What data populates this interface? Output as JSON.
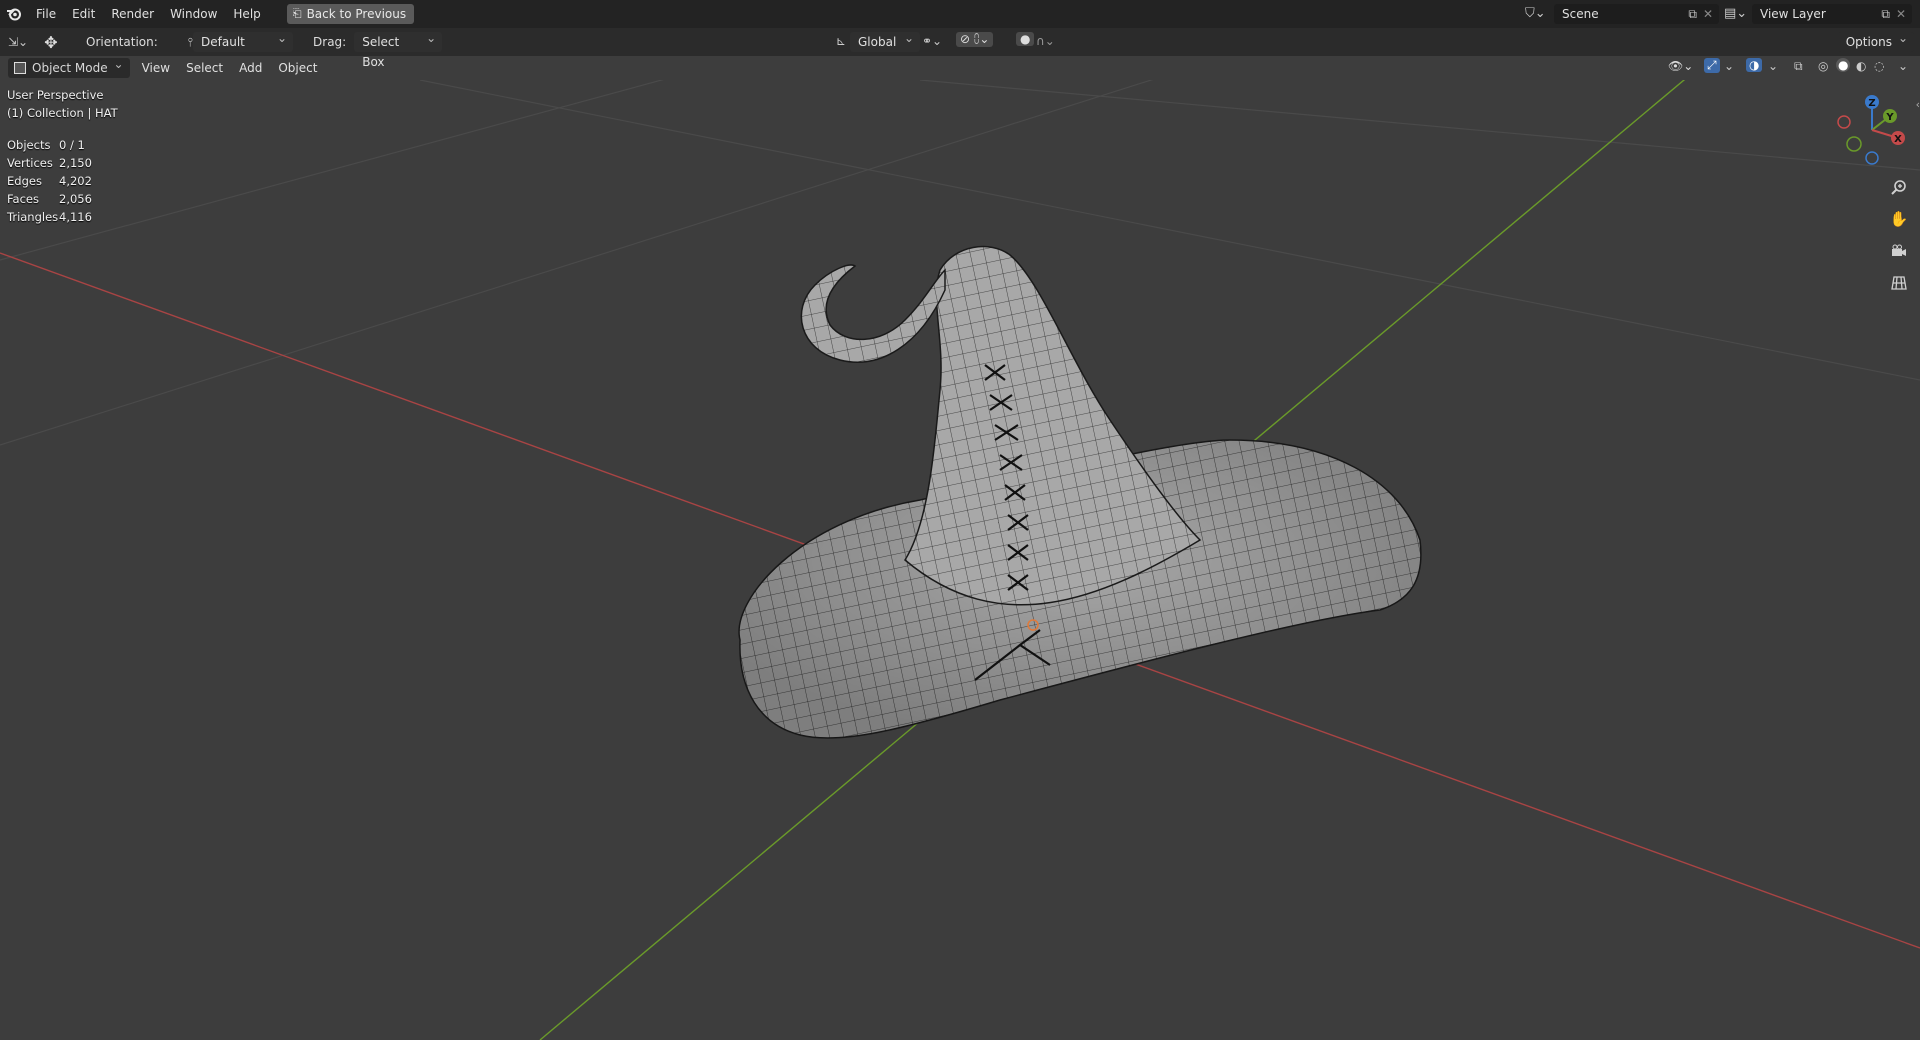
{
  "topbar": {
    "menus": [
      "File",
      "Edit",
      "Render",
      "Window",
      "Help"
    ],
    "back_label": "Back to Previous",
    "scene_name": "Scene",
    "view_layer": "View Layer"
  },
  "toolbar": {
    "orientation_label": "Orientation:",
    "orientation_value": "Default",
    "drag_label": "Drag:",
    "drag_value": "Select Box",
    "transform_orientation": "Global",
    "options_label": "Options"
  },
  "header": {
    "mode": "Object Mode",
    "view": "View",
    "select": "Select",
    "add": "Add",
    "object": "Object"
  },
  "viewport": {
    "perspective": "User Perspective",
    "collection": "(1) Collection | HAT",
    "stats": [
      {
        "label": "Objects",
        "value": "0 / 1"
      },
      {
        "label": "Vertices",
        "value": "2,150"
      },
      {
        "label": "Edges",
        "value": "4,202"
      },
      {
        "label": "Faces",
        "value": "2,056"
      },
      {
        "label": "Triangles",
        "value": "4,116"
      }
    ],
    "axis_colors": {
      "x": "#c44a4a",
      "y": "#6a9a2a",
      "z": "#3a7acc"
    },
    "gizmo_labels": {
      "x": "X",
      "y": "Y",
      "z": "Z"
    }
  },
  "icons": {
    "blender": "blender-logo-icon",
    "zoom": "zoom-icon",
    "pan": "hand-icon",
    "camera": "camera-icon",
    "grid": "grid-icon"
  }
}
